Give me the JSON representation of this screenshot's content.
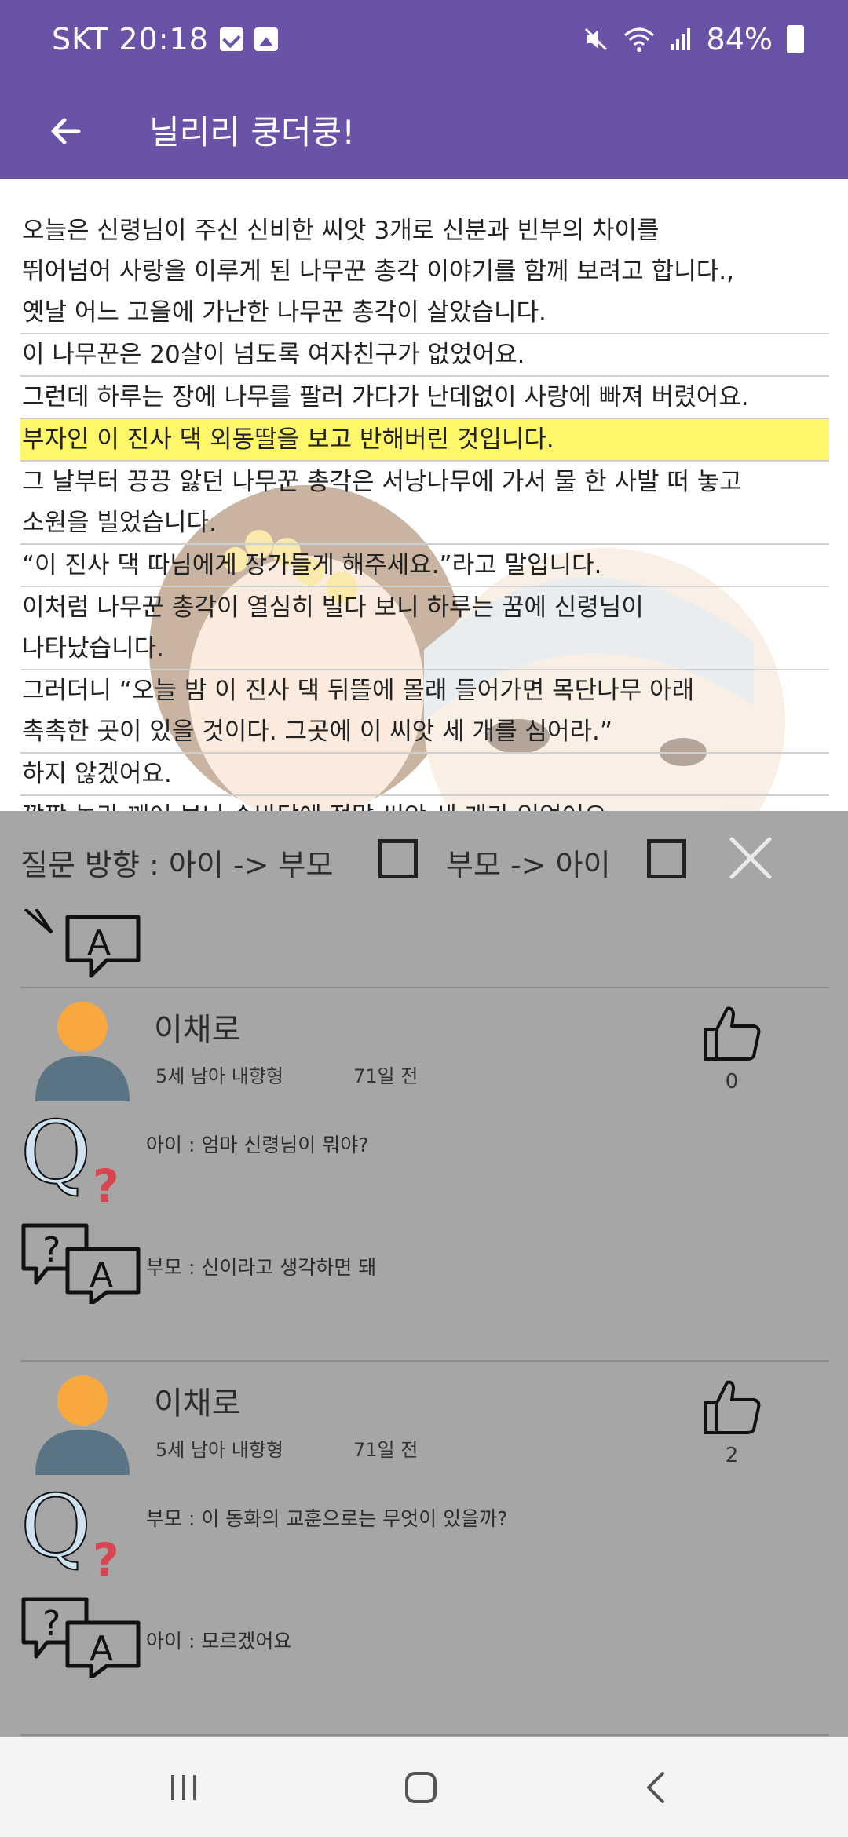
{
  "status": {
    "carrier_time": "SKT 20:18",
    "battery": "84%",
    "icons": [
      "check-notification-icon",
      "image-notification-icon",
      "mute-icon",
      "wifi-icon",
      "signal-icon",
      "battery-icon"
    ]
  },
  "appbar": {
    "title": "닐리리 쿵더쿵!",
    "back_icon": "arrow-left-icon"
  },
  "story": {
    "lines": [
      "오늘은 신령님이 주신 신비한 씨앗 3개로 신분과 빈부의 차이를",
      "뛰어넘어 사랑을 이루게 된 나무꾼 총각 이야기를 함께 보려고 합니다.,",
      "옛날 어느 고을에 가난한 나무꾼 총각이 살았습니다.",
      "이 나무꾼은 20살이 넘도록 여자친구가 없었어요.",
      "그런데 하루는 장에 나무를 팔러 가다가 난데없이 사랑에 빠져 버렸어요.",
      "부자인 이 진사 댁 외동딸을 보고 반해버린 것입니다.",
      "그 날부터 끙끙 앓던 나무꾼 총각은 서낭나무에 가서 물 한 사발 떠 놓고",
      "소원을 빌었습니다.",
      "“이 진사 댁 따님에게 장가들게 해주세요.”라고 말입니다.",
      "이처럼 나무꾼 총각이 열심히 빌다 보니 하루는 꿈에 신령님이",
      "나타났습니다.",
      "그러더니 “오늘 밤 이 진사 댁 뒤뜰에 몰래 들어가면 목단나무 아래",
      "촉촉한 곳이 있을 것이다. 그곳에 이 씨앗 세 개를 심어라.”",
      "하지 않겠어요.",
      "깜짝 놀라 깨어 보니 손바닥에 정말 씨앗 세 개가 있었어요."
    ],
    "highlight_index": 5,
    "pause_icon": "pause-icon"
  },
  "sheet": {
    "direction_label_child_to_parent": "질문 방향 : 아이 -> 부모",
    "direction_label_parent_to_child": "부모 -> 아이",
    "close_icon": "close-icon",
    "comments": [
      {
        "username": "이채로",
        "profile": "5세 남아 내향형",
        "age": "71일 전",
        "likes": "0",
        "question": "아이 : 엄마 신령님이 뭐야?",
        "answer": "부모 : 신이라고 생각하면 돼"
      },
      {
        "username": "이채로",
        "profile": "5세 남아 내향형",
        "age": "71일 전",
        "likes": "2",
        "question": "부모 : 이 동화의 교훈으로는 무엇이 있을까?",
        "answer": "아이 : 모르겠어요"
      }
    ]
  },
  "navbar": {
    "recent_icon": "recent-apps-icon",
    "home_icon": "home-icon",
    "back_icon": "back-chevron-icon"
  },
  "colors": {
    "primary": "#6a52a6",
    "highlight": "#fff76a",
    "fab": "#f2558c",
    "sheet": "#a6a6a6",
    "avatar_head": "#f7a940",
    "avatar_body": "#5a7483"
  }
}
